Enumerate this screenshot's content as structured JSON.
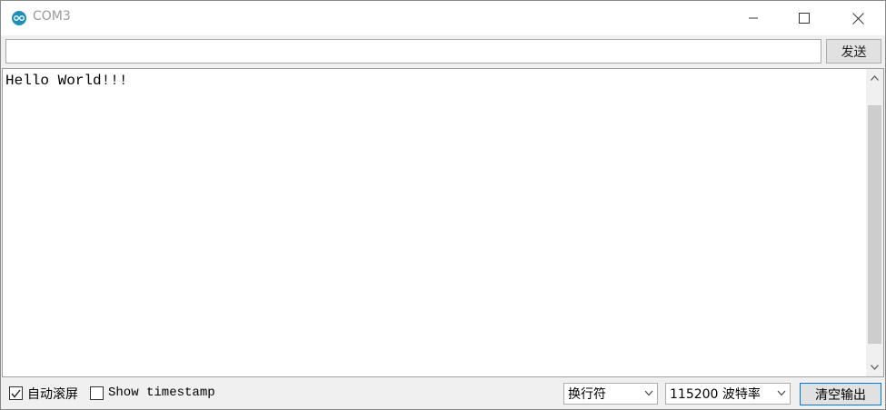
{
  "window": {
    "title": "COM3",
    "icon": "arduino-icon"
  },
  "send": {
    "input_value": "",
    "button_label": "发送"
  },
  "output": {
    "text": "Hello World!!!"
  },
  "bottom": {
    "autoscroll_label": "自动滚屏",
    "autoscroll_checked": true,
    "timestamp_label": "Show timestamp",
    "timestamp_checked": false,
    "line_ending": "换行符",
    "baud_rate": "115200 波特率",
    "clear_label": "清空输出"
  },
  "colors": {
    "accent": "#0078d7",
    "icon_bg": "#1f8fb8"
  }
}
